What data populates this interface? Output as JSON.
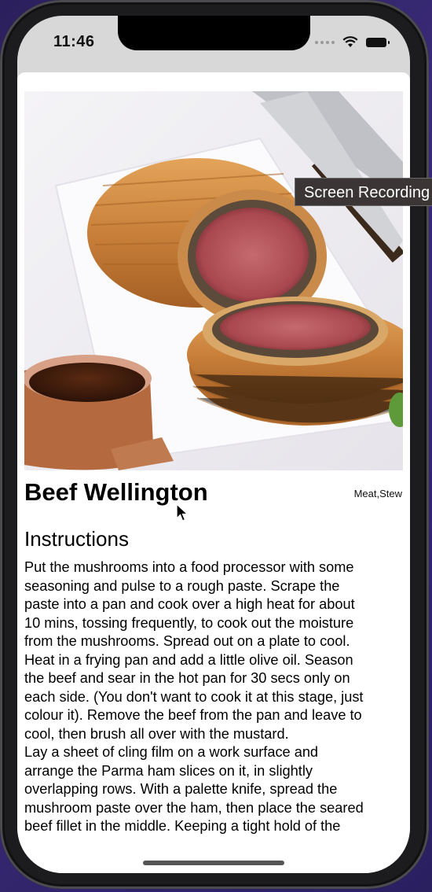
{
  "status_bar": {
    "time": "11:46"
  },
  "recipe": {
    "image_alt": "Beef Wellington",
    "title": "Beef Wellington",
    "tags": "Meat,Stew",
    "instructions_heading": "Instructions",
    "instructions_lines": [
      "Put the mushrooms into a food processor with some",
      "seasoning and pulse to a rough paste. Scrape the",
      "paste into a pan and cook over a high heat for about",
      "10 mins, tossing frequently, to cook out the moisture",
      "from the mushrooms. Spread out on a plate to cool.",
      "Heat in a frying pan and add a little olive oil. Season",
      "the beef and sear in the hot pan for 30 secs only on",
      "each side. (You don't want to cook it at this stage, just",
      "colour it). Remove the beef from the pan and leave to",
      "cool, then brush all over with the mustard.",
      "Lay a sheet of cling film on a work surface and",
      "arrange the Parma ham slices on it, in slightly",
      "overlapping rows. With a palette knife, spread the",
      "mushroom paste over the ham, then place the seared",
      "beef fillet in the middle. Keeping a tight hold of the"
    ]
  },
  "overlay": {
    "tooltip": "Screen Recording"
  },
  "icons": {
    "signal": "cellular-signal-icon",
    "wifi": "wifi-icon",
    "battery": "battery-icon",
    "cursor": "mouse-pointer-icon"
  }
}
